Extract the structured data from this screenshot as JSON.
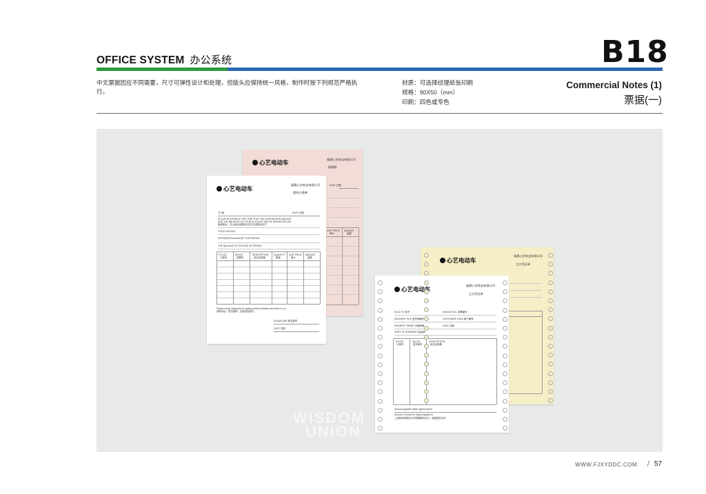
{
  "header": {
    "section_title_en": "OFFICE SYSTEM",
    "section_title_cn": "办公系统",
    "code": "B18",
    "description": "中文票据因应不同需要，尺寸可弹性设计和处理，但版头应保持统一风格，制作时按下列规范严格执行。",
    "specs": [
      "材质：可选择纹理纸张印刷",
      "规格：90X50（mm）",
      "印刷：四色或专色"
    ],
    "doc_title_en": "Commercial Notes (1)",
    "doc_title_cn": "票据(一)"
  },
  "sheets": {
    "brand": "心艺电动车",
    "company": "福建心艺车业有限公司",
    "pink_copy": "顾客联",
    "white_copy": "遗失公差单",
    "yellow_copy": "三方凭证单",
    "white_copy2": "三方凭证单",
    "stmt_lines": [
      "TO  致:",
      "DATE 日期:",
      "IN OUR ROUTINE AT THIS TIME THAT THE INTEGRATION AMOUNT",
      "AND THE BALANCE ON YOUR ACCOUNT ARE AS SHOWN BELOW.",
      "敬请核对，并以此份结算单与贵方记录核对如下",
      "TOTAL INVOICE",
      "INTEGRATION AMOUNT THIS PERIOD",
      "THE BALANCE AT THE END OF PERIOD"
    ],
    "stmt_columns": [
      "P.O.NO.",
      "INV.NO.",
      "DESCRIPTION",
      "QUANTITY",
      "UNIT PRICE",
      "AMOUNT"
    ],
    "stmt_columns_cn": [
      "订单号",
      "发票号",
      "品名及规格",
      "数量",
      "单价",
      "金额"
    ],
    "stmt_footer": [
      "Please check statement by signing sheet indicated and return to us.",
      "请核对后，签字盖章，并返回给我方。",
      "SIGNATURE 签名盖章",
      "DATE 日期"
    ],
    "inv_lines": [
      "SOLD TO 售予:",
      "INVOICE NO. 发票编号:",
      "DELIVERY SLIP 送货单编号:",
      "CUSTOMER CODE 客户编号:",
      "PAYMENT TERMS 付款期限:",
      "DATE 日期:",
      "PORT OF SHIPMENT 起运港"
    ],
    "inv_columns": [
      "P.O.NO.",
      "INV.NO.",
      "DESCRIPTION"
    ],
    "inv_columns_cn": [
      "订单号",
      "送货单号",
      "品名及规格"
    ],
    "inv_footer": [
      "Amount payable within agreed terms",
      "Amount / Invoice be made payable to",
      "上述款项请按双方同意期限内支付，谢谢您的合作"
    ],
    "pink_columns": [
      "UNIT PRICE",
      "AMOUNT"
    ],
    "pink_columns_cn": [
      "单价",
      "金额"
    ],
    "pink_date": "DATE 日期:"
  },
  "watermark": [
    "WISDOM",
    "UNION"
  ],
  "footer": {
    "url": "WWW.FJXYDDC.COM",
    "page": "57"
  },
  "colors": {
    "green_bar": "#2f9a3f",
    "blue_bar": "#2c67b0",
    "panel": "#e8eaea",
    "pink_sheet": "#f2dcd8",
    "yellow_sheet": "#f6eec7"
  }
}
